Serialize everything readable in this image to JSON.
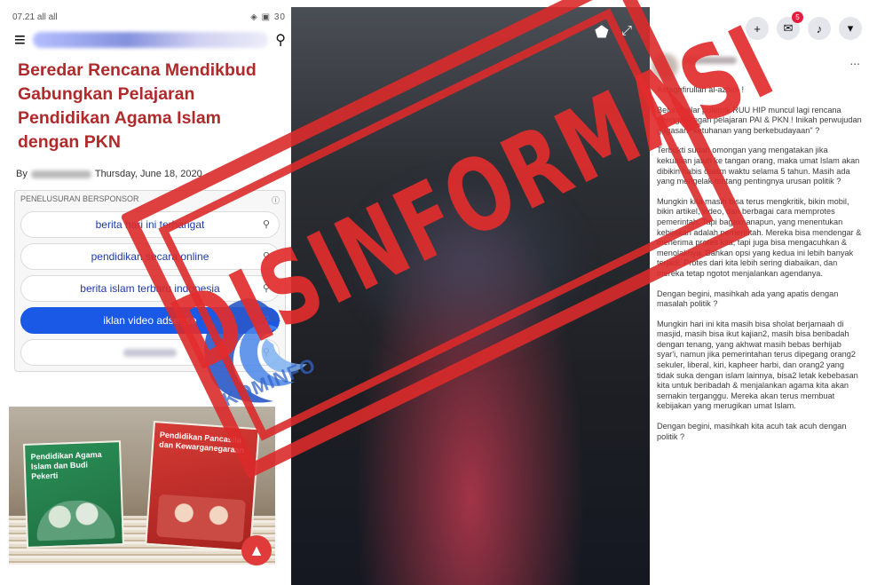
{
  "phone": {
    "status_time": "07.21",
    "status_icons_left": "all all",
    "status_icons_right": "30",
    "headline": "Beredar Rencana Mendikbud Gabungkan Pelajaran Pendidikan Agama Islam dengan PKN",
    "byline_prefix": "By",
    "date": "Thursday, June 18, 2020",
    "byline_suffix": "-",
    "sponsored_label": "PENELUSURAN BERSPONSOR",
    "sponsored_info_icon": "info-icon",
    "search_pills": [
      {
        "label": "berita hari ini terhangat"
      },
      {
        "label": "pendidikan secara online"
      },
      {
        "label": "berita islam terbaru indonesia"
      },
      {
        "label": "iklan video adsense"
      }
    ],
    "book_left_title": "Pendidikan Agama Islam dan Budi Pekerti",
    "book_right_title": "Pendidikan Pancasila dan Kewarganegaraan"
  },
  "fb_post": {
    "paragraphs": [
      "Astaghfirullah al-azhim !",
      "Belum kelar polemik RUU HIP muncul lagi rencana penggabungan pelajaran PAI & PKN ! Inikah perwujudan gagasan \"ketuhanan yang berkebudayaan\" ?",
      "Terbukti sudah omongan yang mengatakan jika kekuasan jatuh ke tangan orang, maka umat Islam akan dibikin habis dalam waktu selama 5 tahun. Masih ada yang mengelak tentang pentingnya urusan politik ?",
      "Mungkin kita masih bisa terus mengkritik, bikin mobil, bikin artikel, video, dan berbagai cara memprotes pemerintah. Tapi bagaimanapun, yang menentukan kebijakan adalah pemerintah. Mereka bisa mendengar & menerima protes kita, tapi juga bisa mengacuhkan & menolaknya. Bahkan opsi yang kedua ini lebih banyak terjadi. Protes dari kita lebih sering diabaikan, dan mereka tetap ngotot menjalankan agendanya.",
      "Dengan begini, masihkah ada yang apatis dengan masalah politik ?",
      "Mungkin hari ini kita masih bisa sholat berjamaah di masjid, masih bisa ikut kajian2, masih bisa beribadah dengan tenang, yang akhwat masih bebas berhijab syar'i, namun jika pemerintahan terus dipegang orang2 sekuler, liberal, kiri, kapheer harbi, dan orang2 yang tidak suka dengan islam lainnya, bisa2 letak kebebasan kita untuk beribadah & menjalankan agama kita akan semakin terganggu. Mereka akan terus membuat kebijakan yang merugikan umat Islam.",
      "Dengan begini, masihkah kita acuh tak acuh dengan politik ?"
    ]
  },
  "toolbar": {
    "plus_label": "+",
    "messenger_badge": "5",
    "more_label": "...",
    "scroll_top_label": "^"
  },
  "overlay": {
    "stamp_text": "DISINFORMASI",
    "logo_text": "KOMINFO"
  },
  "colors": {
    "headline_red": "#b0292b",
    "stamp_red": "#da2a2a",
    "pill_active_blue": "#1a59e6",
    "fb_badge_red": "#e41e3f",
    "kominfo_blue": "#2c5fc0"
  },
  "icons": [
    "hamburger-icon",
    "search-icon",
    "tag-icon",
    "expand-icon",
    "plus-icon",
    "messenger-icon",
    "bell-icon",
    "chevron-down-icon",
    "magnifier-icon",
    "chevron-up-icon"
  ]
}
